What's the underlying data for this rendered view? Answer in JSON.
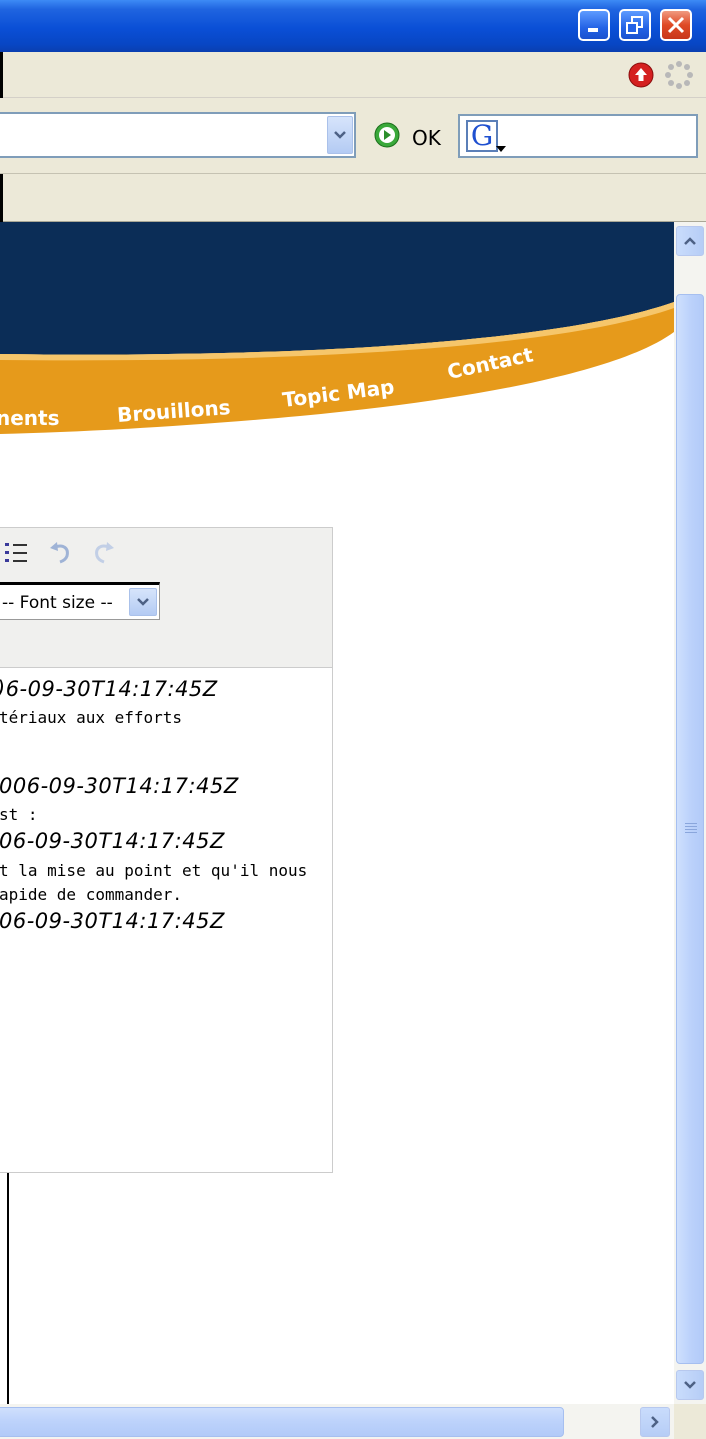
{
  "window": {
    "buttons": [
      "minimize",
      "restore",
      "close"
    ]
  },
  "toolbar": {
    "go_label": "OK",
    "google_letter": "G"
  },
  "site_nav": {
    "items": [
      "nents",
      "Brouillons",
      "Topic Map",
      "Contact"
    ],
    "colors": {
      "banner": "#0b2d57",
      "swoosh": "#e69a1b"
    }
  },
  "editor": {
    "font_size_select": "-- Font size --",
    "lines": [
      {
        "kind": "timestamp",
        "text": ")6-09-30T14:17:45Z"
      },
      {
        "kind": "text",
        "text": "tériaux aux efforts"
      },
      {
        "kind": "timestamp",
        "text": "006-09-30T14:17:45Z"
      },
      {
        "kind": "text",
        "text": "st :"
      },
      {
        "kind": "timestamp",
        "text": "06-09-30T14:17:45Z"
      },
      {
        "kind": "text",
        "text": "t la mise au point et qu'il nous"
      },
      {
        "kind": "text",
        "text": "apide de commander."
      },
      {
        "kind": "timestamp",
        "text": "06-09-30T14:17:45Z"
      }
    ]
  }
}
